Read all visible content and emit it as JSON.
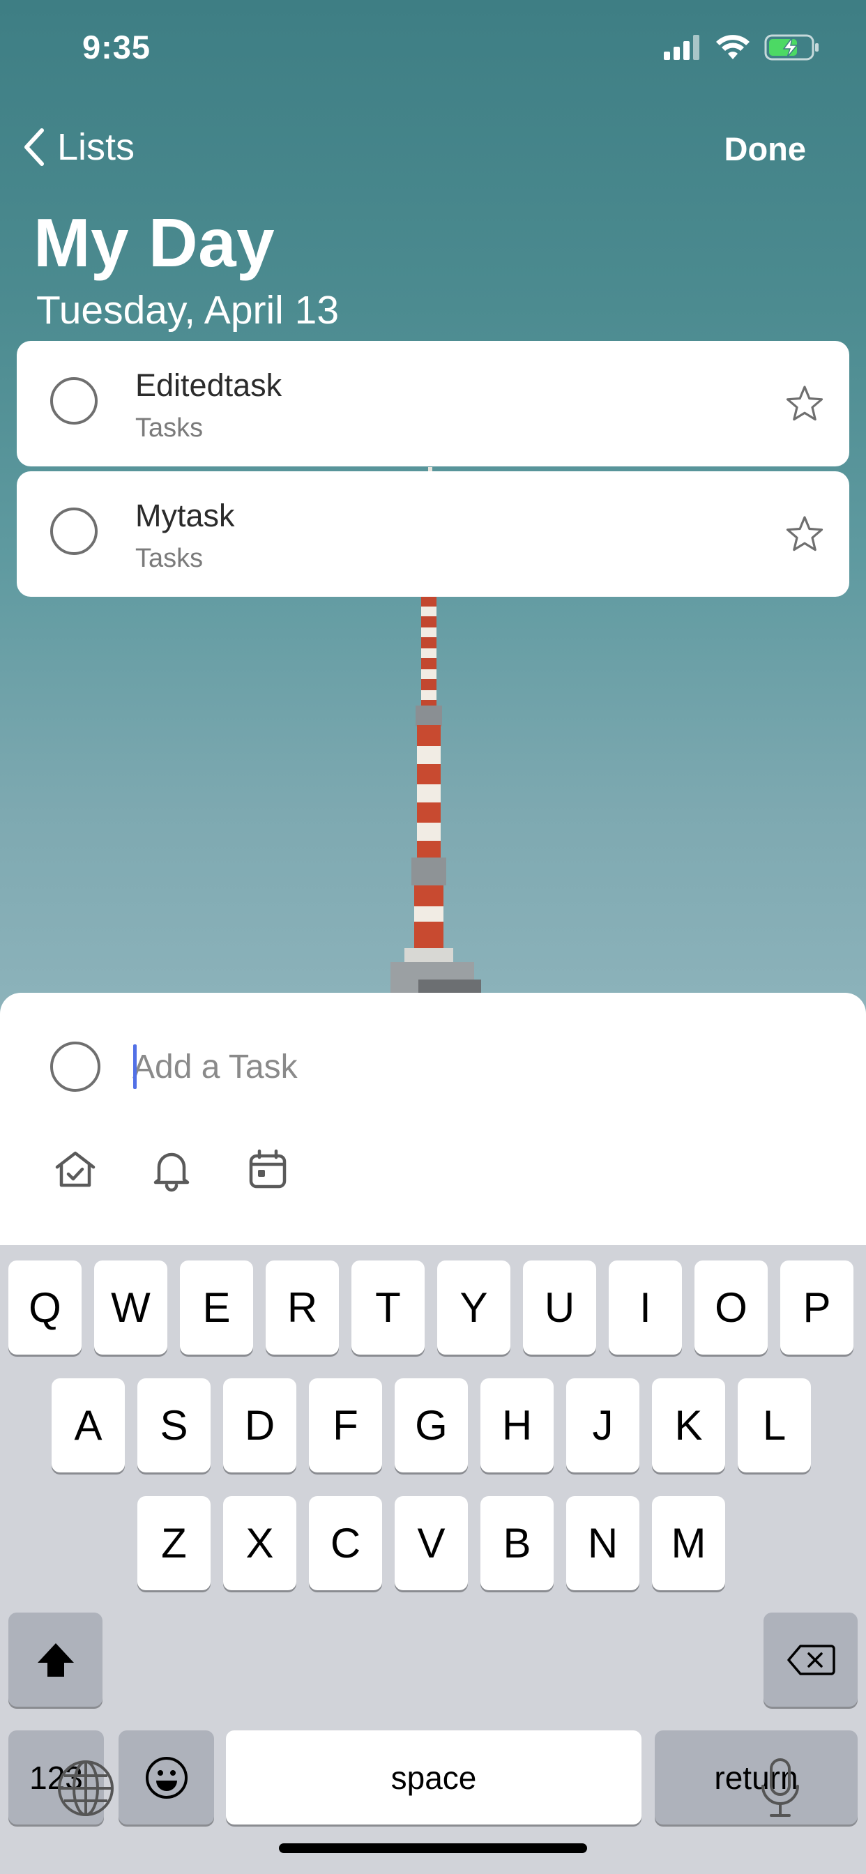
{
  "status_bar": {
    "time": "9:35"
  },
  "nav": {
    "back_label": "Lists",
    "done_label": "Done"
  },
  "header": {
    "title": "My Day",
    "date": "Tuesday, April 13"
  },
  "tasks": [
    {
      "title": "Editedtask",
      "list": "Tasks"
    },
    {
      "title": "Mytask",
      "list": "Tasks"
    }
  ],
  "add_task": {
    "placeholder": "Add a Task",
    "value": ""
  },
  "sheet_icons": [
    "add-to-my-day-icon",
    "reminder-bell-icon",
    "due-date-calendar-icon"
  ],
  "keyboard": {
    "row1": [
      "Q",
      "W",
      "E",
      "R",
      "T",
      "Y",
      "U",
      "I",
      "O",
      "P"
    ],
    "row2": [
      "A",
      "S",
      "D",
      "F",
      "G",
      "H",
      "J",
      "K",
      "L"
    ],
    "row3": [
      "Z",
      "X",
      "C",
      "V",
      "B",
      "N",
      "M"
    ],
    "numbers_label": "123",
    "space_label": "space",
    "return_label": "return"
  },
  "colors": {
    "card": "#ffffff",
    "accent_caret": "#5270e6",
    "background_teal": "#4c8b90"
  }
}
